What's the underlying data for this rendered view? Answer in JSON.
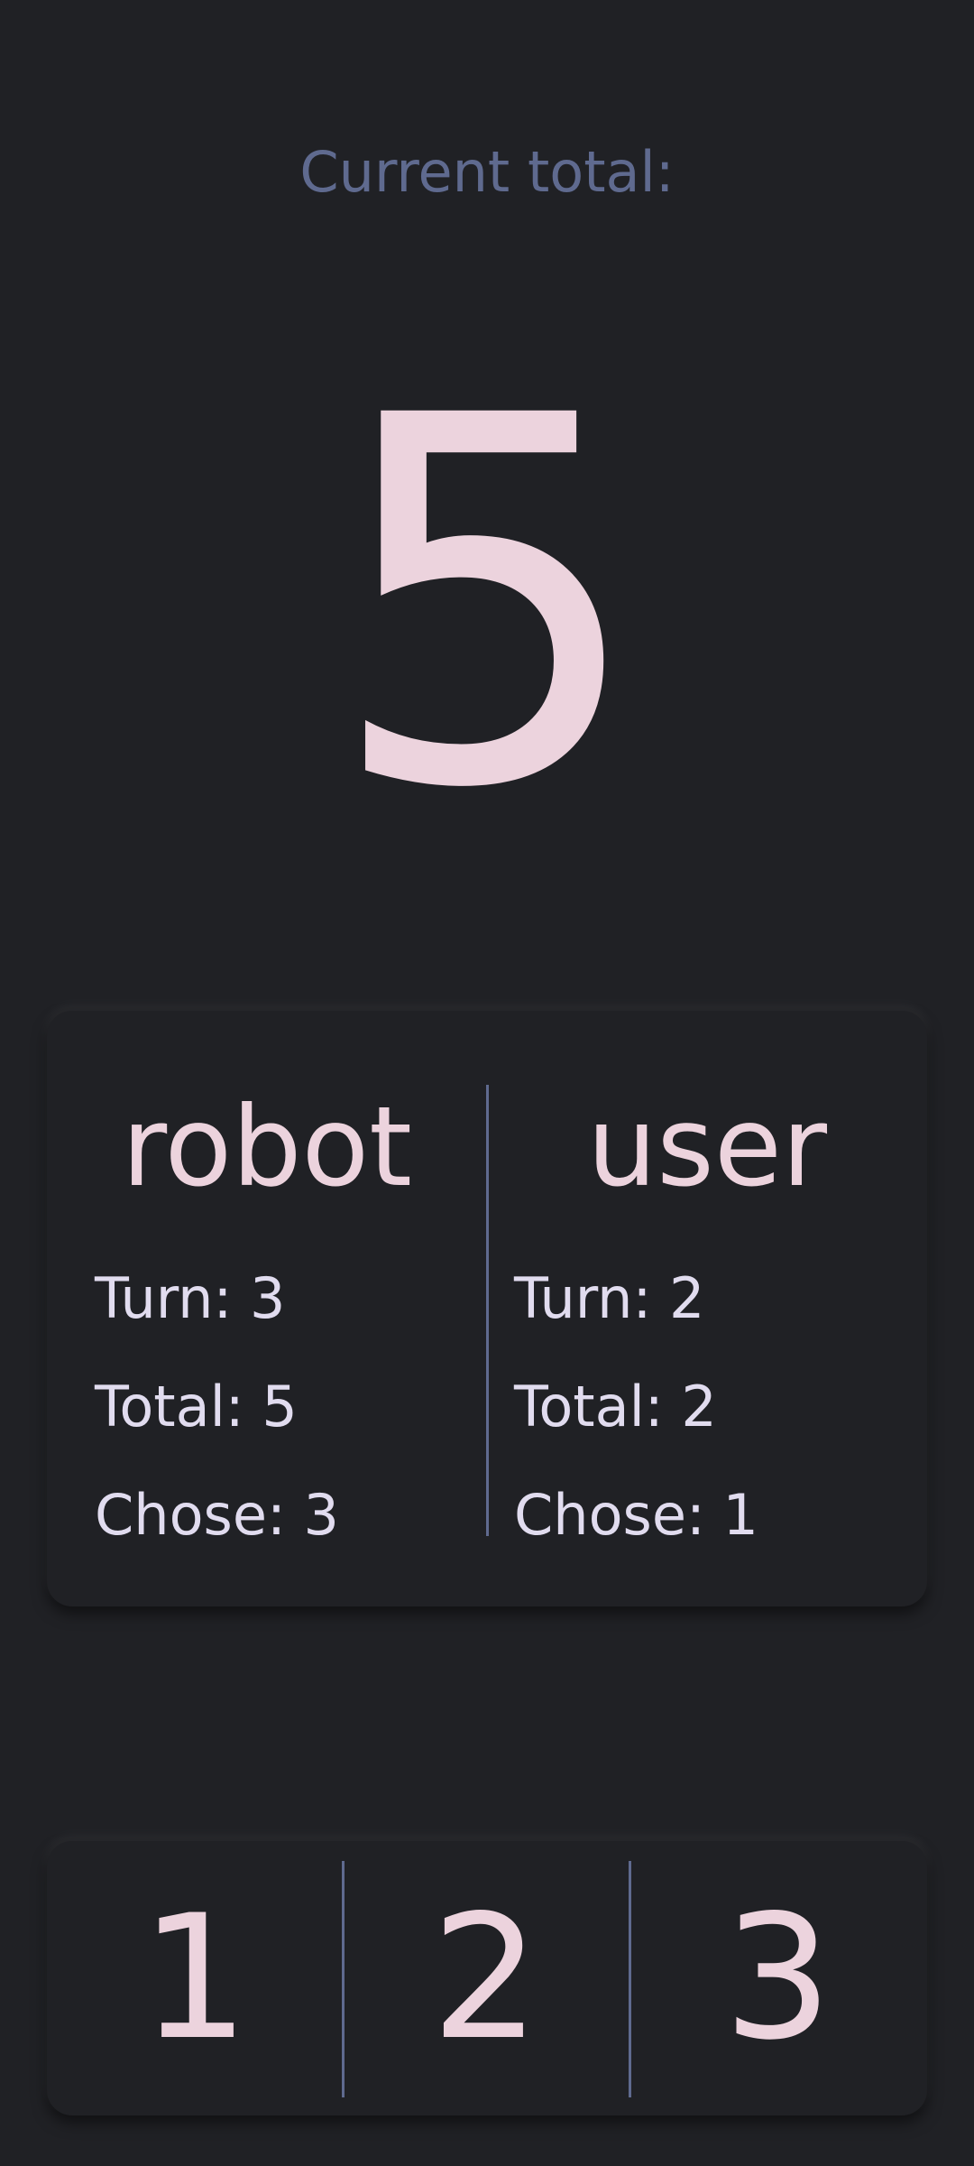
{
  "header": {
    "total_label": "Current total:",
    "total_value": "5"
  },
  "players": {
    "robot": {
      "name": "robot",
      "turn": "Turn: 3",
      "total": "Total: 5",
      "chose": "Chose: 3"
    },
    "user": {
      "name": "user",
      "turn": "Turn: 2",
      "total": "Total: 2",
      "chose": "Chose: 1"
    }
  },
  "choices": [
    "1",
    "2",
    "3"
  ],
  "colors": {
    "background": "#202125",
    "accent_text": "#ecd3dd",
    "muted_text": "#5f6a8f",
    "stat_text": "#e1dcef"
  }
}
